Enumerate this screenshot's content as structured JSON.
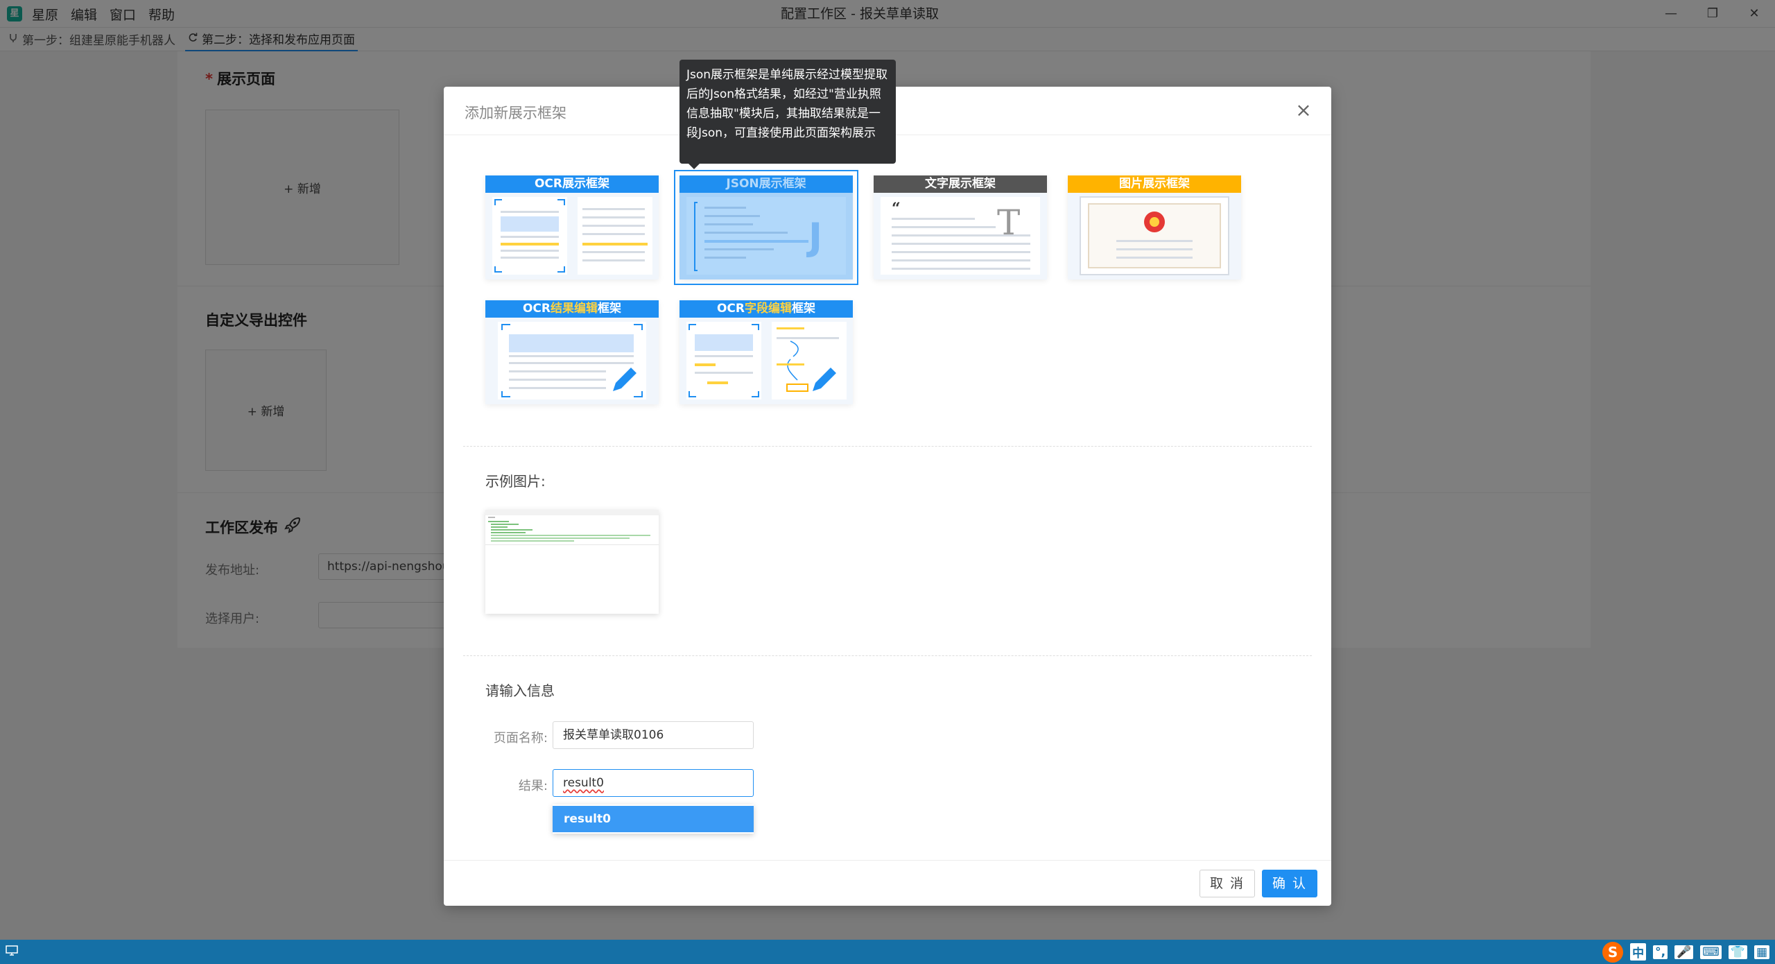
{
  "window": {
    "title": "配置工作区 - 报关草单读取",
    "logo": "星",
    "menu": [
      "星原",
      "编辑",
      "窗口",
      "帮助"
    ],
    "controls": {
      "minimize": "—",
      "restore": "❐",
      "close": "✕"
    }
  },
  "steps": [
    {
      "label": "第一步：组建星原能手机器人",
      "icon": "fork-icon"
    },
    {
      "label": "第二步：选择和发布应用页面",
      "icon": "refresh-icon",
      "active": true
    }
  ],
  "page": {
    "display_section": {
      "required_mark": "*",
      "title": "展示页面",
      "add_label": "+ 新增"
    },
    "export_section": {
      "title": "自定义导出控件",
      "add_label": "+ 新增"
    },
    "publish_section": {
      "title": "工作区发布",
      "icon": "rocket-icon",
      "address_label": "发布地址:",
      "address_value": "https://api-nengshou",
      "user_label": "选择用户:",
      "user_value": ""
    }
  },
  "modal": {
    "title": "添加新展示框架",
    "close_label": "×",
    "frames": [
      {
        "id": "ocr",
        "title_parts": [
          "OCR展示框架"
        ],
        "color": "#1f8ff2"
      },
      {
        "id": "json",
        "title_parts": [
          "JSON展示框架"
        ],
        "color": "#1f8ff2",
        "selected": true
      },
      {
        "id": "text",
        "title_parts": [
          "文字展示框架"
        ],
        "color": "#555555"
      },
      {
        "id": "image",
        "title_parts": [
          "图片展示框架"
        ],
        "color": "#ffb300"
      },
      {
        "id": "ocr-result-edit",
        "title_parts": [
          "OCR",
          "结果编辑",
          "框架"
        ],
        "color": "#1f8ff2"
      },
      {
        "id": "ocr-field-edit",
        "title_parts": [
          "OCR",
          "字段编辑",
          "框架"
        ],
        "color": "#1f8ff2"
      }
    ],
    "sample_label": "示例图片:",
    "info_title": "请输入信息",
    "page_name_label": "页面名称:",
    "page_name_value": "报关草单读取0106",
    "result_label": "结果:",
    "result_value": "result0",
    "dropdown_option": "result0",
    "cancel_label": "取 消",
    "ok_label": "确 认"
  },
  "tooltip": {
    "text": "Json展示框架是单纯展示经过模型提取后的Json格式结果，如经过\"营业执照信息抽取\"模块后，其抽取结果就是一段Json，可直接使用此页面架构展示"
  },
  "taskbar": {
    "ime": {
      "logo": "S",
      "mode": "中",
      "punct": "°,",
      "mic": "🎤",
      "keyboard": "⌨",
      "skin": "👕",
      "grid": "▦"
    }
  },
  "colors": {
    "accent": "#1f8ff2",
    "taskbar": "#1570a6",
    "tooltip_bg": "#303133"
  }
}
